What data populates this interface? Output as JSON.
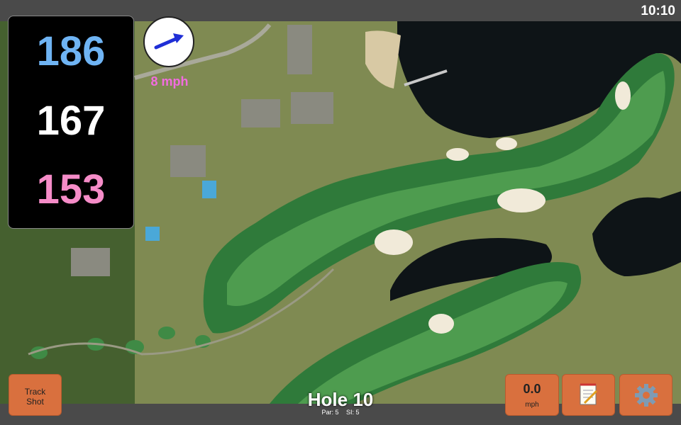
{
  "status_bar": {
    "time": "10:10"
  },
  "distances": {
    "back": "186",
    "middle": "167",
    "front": "153"
  },
  "wind": {
    "speed": "8 mph"
  },
  "hole": {
    "title": "Hole 10",
    "par": "Par: 5",
    "si": "SI: 5"
  },
  "buttons": {
    "track_shot_line1": "Track",
    "track_shot_line2": "Shot",
    "speed_value": "0.0",
    "speed_unit": "mph",
    "notes_icon": "notepad-icon",
    "settings_icon": "gear-icon"
  },
  "colors": {
    "back": "#6fb4f4",
    "middle": "#ffffff",
    "front": "#f58cc8",
    "wind": "#f26ce0",
    "button": "#d9703e"
  }
}
